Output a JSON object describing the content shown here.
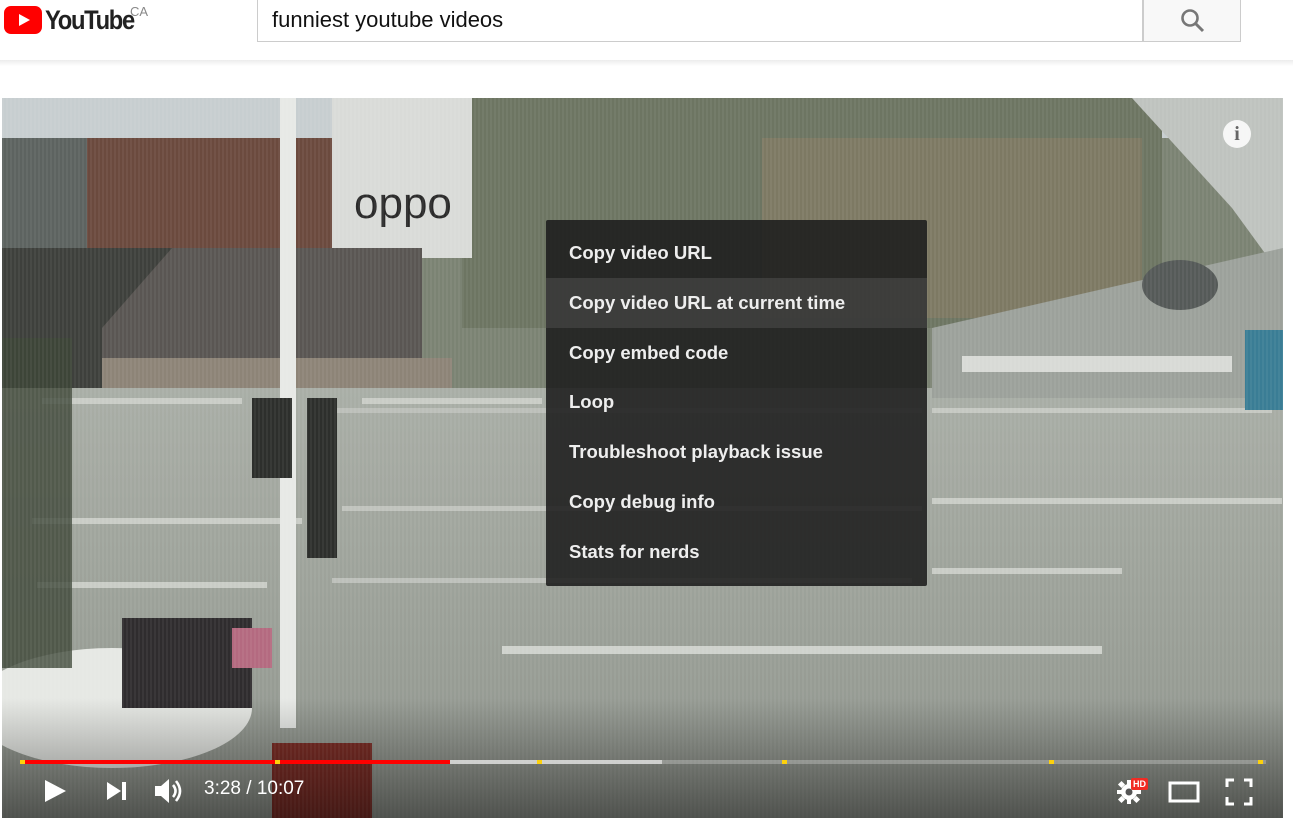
{
  "header": {
    "logo_text": "YouTube",
    "country_code": "CA",
    "search_value": "funniest youtube videos"
  },
  "player": {
    "current_time": "3:28",
    "duration": "10:07",
    "time_display": "3:28 / 10:07",
    "info_label": "i",
    "hd_badge": "HD",
    "progress": {
      "played_fraction": 0.345,
      "buffered_fraction": 0.515,
      "accent_color": "#ff0000",
      "marker_color": "#fcd10c"
    }
  },
  "context_menu": {
    "items": [
      {
        "label": "Copy video URL"
      },
      {
        "label": "Copy video URL at current time"
      },
      {
        "label": "Copy embed code"
      },
      {
        "label": "Loop"
      },
      {
        "label": "Troubleshoot playback issue"
      },
      {
        "label": "Copy debug info"
      },
      {
        "label": "Stats for nerds"
      }
    ],
    "hovered_index": 1
  },
  "icons": {
    "play": "play-icon",
    "next": "next-icon",
    "volume": "volume-icon",
    "settings": "settings-gear-icon",
    "theater": "theater-mode-icon",
    "fullscreen": "fullscreen-icon",
    "search": "search-icon",
    "info": "info-icon"
  }
}
